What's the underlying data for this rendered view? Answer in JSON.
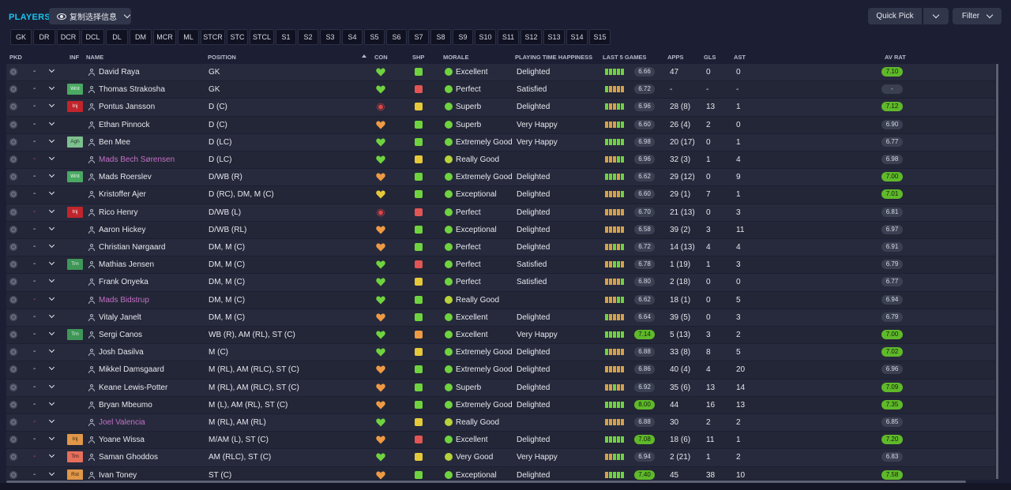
{
  "title": "PLAYERS",
  "copy_button": "复制选择信息",
  "quick_pick": "Quick Pick",
  "filter": "Filter",
  "position_tabs": [
    "GK",
    "DR",
    "DCR",
    "DCL",
    "DL",
    "DM",
    "MCR",
    "ML",
    "STCR",
    "STC",
    "STCL",
    "S1",
    "S2",
    "S3",
    "S4",
    "S5",
    "S6",
    "S7",
    "S8",
    "S9",
    "S10",
    "S11",
    "S12",
    "S13",
    "S14",
    "S15"
  ],
  "columns": {
    "pkd": "PKD",
    "inf": "INF",
    "name": "NAME",
    "position": "POSITION",
    "con": "CON",
    "shp": "SHP",
    "morale": "MORALE",
    "pth": "PLAYING TIME HAPPINESS",
    "form": "LAST 5 GAMES",
    "apps": "APPS",
    "gls": "GLS",
    "ast": "AST",
    "avrat": "AV RAT"
  },
  "colors": {
    "accent": "#19c3f0",
    "green": "#6fd33f",
    "red": "#e04343",
    "yellow": "#e5c93a",
    "orange": "#ee9a44",
    "loan": "#c470c9"
  },
  "players": [
    {
      "name": "David Raya",
      "loan": false,
      "inf": "",
      "position": "GK",
      "con": "green",
      "shp": "green-up",
      "morale": "Excellent",
      "pth": "Delighted",
      "form": [
        "g",
        "g",
        "g",
        "g",
        "g"
      ],
      "form_avg": "6.66",
      "apps": "47",
      "gls": "0",
      "ast": "0",
      "avrat": "7.10",
      "avrat_green": true,
      "dash_red": false
    },
    {
      "name": "Thomas Strakosha",
      "loan": false,
      "inf": "Wnt",
      "position": "GK",
      "con": "green",
      "shp": "red-down",
      "morale": "Perfect",
      "pth": "Satisfied",
      "form": [
        "g",
        "o",
        "o",
        "o",
        "o"
      ],
      "form_avg": "6.72",
      "apps": "-",
      "gls": "-",
      "ast": "-",
      "avrat": "-",
      "avrat_green": false,
      "dash_red": false
    },
    {
      "name": "Pontus Jansson",
      "loan": false,
      "inf": "Inj",
      "position": "D (C)",
      "con": "red",
      "shp": "yellow",
      "morale": "Superb",
      "pth": "Delighted",
      "form": [
        "g",
        "o",
        "o",
        "g",
        "g"
      ],
      "form_avg": "6.96",
      "apps": "28 (8)",
      "gls": "13",
      "ast": "1",
      "avrat": "7.12",
      "avrat_green": true,
      "dash_red": false
    },
    {
      "name": "Ethan Pinnock",
      "loan": false,
      "inf": "",
      "position": "D (C)",
      "con": "orange",
      "shp": "green-up",
      "morale": "Superb",
      "pth": "Very Happy",
      "form": [
        "o",
        "o",
        "o",
        "g",
        "g"
      ],
      "form_avg": "6.60",
      "apps": "26 (4)",
      "gls": "2",
      "ast": "0",
      "avrat": "6.90",
      "avrat_green": false,
      "dash_red": false
    },
    {
      "name": "Ben Mee",
      "loan": false,
      "inf": "Agh",
      "position": "D (LC)",
      "con": "green",
      "shp": "green-up",
      "morale": "Extremely Good",
      "pth": "Very Happy",
      "form": [
        "g",
        "g",
        "g",
        "g",
        "g"
      ],
      "form_avg": "6.98",
      "apps": "20 (17)",
      "gls": "0",
      "ast": "1",
      "avrat": "6.77",
      "avrat_green": false,
      "dash_red": false
    },
    {
      "name": "Mads Bech Sørensen",
      "loan": true,
      "inf": "",
      "position": "D (LC)",
      "con": "green",
      "shp": "yellow-dash",
      "morale": "Really Good",
      "pth": "",
      "form": [
        "o",
        "o",
        "o",
        "g",
        "g"
      ],
      "form_avg": "6.96",
      "apps": "32 (3)",
      "gls": "1",
      "ast": "4",
      "avrat": "6.98",
      "avrat_green": false,
      "dash_red": true
    },
    {
      "name": "Mads Roerslev",
      "loan": false,
      "inf": "Wnt",
      "position": "D/WB (R)",
      "con": "orange",
      "shp": "green-up",
      "morale": "Extremely Good",
      "pth": "Delighted",
      "form": [
        "g",
        "g",
        "g",
        "o",
        "g"
      ],
      "form_avg": "6.62",
      "apps": "29 (12)",
      "gls": "0",
      "ast": "9",
      "avrat": "7.00",
      "avrat_green": true,
      "dash_red": false
    },
    {
      "name": "Kristoffer Ajer",
      "loan": false,
      "inf": "",
      "position": "D (RC), DM, M (C)",
      "con": "yellow",
      "shp": "green-up",
      "morale": "Exceptional",
      "pth": "Delighted",
      "form": [
        "o",
        "o",
        "o",
        "o",
        "g"
      ],
      "form_avg": "6.60",
      "apps": "29 (1)",
      "gls": "7",
      "ast": "1",
      "avrat": "7.01",
      "avrat_green": true,
      "dash_red": false
    },
    {
      "name": "Rico Henry",
      "loan": false,
      "inf": "Inj",
      "position": "D/WB (L)",
      "con": "red",
      "shp": "red-down",
      "morale": "Perfect",
      "pth": "Delighted",
      "form": [
        "o",
        "o",
        "o",
        "o",
        "o"
      ],
      "form_avg": "6.70",
      "apps": "21 (13)",
      "gls": "0",
      "ast": "3",
      "avrat": "6.81",
      "avrat_green": false,
      "dash_red": true
    },
    {
      "name": "Aaron Hickey",
      "loan": false,
      "inf": "",
      "position": "D/WB (RL)",
      "con": "orange",
      "shp": "green-up",
      "morale": "Exceptional",
      "pth": "Delighted",
      "form": [
        "o",
        "o",
        "o",
        "o",
        "o"
      ],
      "form_avg": "6.58",
      "apps": "39 (2)",
      "gls": "3",
      "ast": "11",
      "avrat": "6.97",
      "avrat_green": false,
      "dash_red": false
    },
    {
      "name": "Christian Nørgaard",
      "loan": false,
      "inf": "",
      "position": "DM, M (C)",
      "con": "orange",
      "shp": "green-up",
      "morale": "Perfect",
      "pth": "Delighted",
      "form": [
        "o",
        "o",
        "g",
        "o",
        "g"
      ],
      "form_avg": "6.72",
      "apps": "14 (13)",
      "gls": "4",
      "ast": "4",
      "avrat": "6.91",
      "avrat_green": false,
      "dash_red": false
    },
    {
      "name": "Mathias Jensen",
      "loan": false,
      "inf": "Trn",
      "position": "DM, M (C)",
      "con": "green",
      "shp": "red-down",
      "morale": "Perfect",
      "pth": "Satisfied",
      "form": [
        "o",
        "o",
        "g",
        "g",
        "o"
      ],
      "form_avg": "6.78",
      "apps": "1 (19)",
      "gls": "1",
      "ast": "3",
      "avrat": "6.79",
      "avrat_green": false,
      "dash_red": false
    },
    {
      "name": "Frank Onyeka",
      "loan": false,
      "inf": "",
      "position": "DM, M (C)",
      "con": "green",
      "shp": "yellow",
      "morale": "Perfect",
      "pth": "Satisfied",
      "form": [
        "o",
        "o",
        "o",
        "o",
        "g"
      ],
      "form_avg": "6.80",
      "apps": "2 (18)",
      "gls": "0",
      "ast": "0",
      "avrat": "6.77",
      "avrat_green": false,
      "dash_red": false
    },
    {
      "name": "Mads Bidstrup",
      "loan": true,
      "inf": "",
      "position": "DM, M (C)",
      "con": "green",
      "shp": "green-up",
      "morale": "Really Good",
      "pth": "",
      "form": [
        "o",
        "o",
        "o",
        "g",
        "g"
      ],
      "form_avg": "6.62",
      "apps": "18 (1)",
      "gls": "0",
      "ast": "5",
      "avrat": "6.94",
      "avrat_green": false,
      "dash_red": true
    },
    {
      "name": "Vitaly Janelt",
      "loan": false,
      "inf": "",
      "position": "DM, M (C)",
      "con": "orange",
      "shp": "green-up",
      "morale": "Excellent",
      "pth": "Delighted",
      "form": [
        "g",
        "o",
        "o",
        "o",
        "o"
      ],
      "form_avg": "6.64",
      "apps": "39 (5)",
      "gls": "0",
      "ast": "3",
      "avrat": "6.79",
      "avrat_green": false,
      "dash_red": false
    },
    {
      "name": "Sergi Canos",
      "loan": false,
      "inf": "Trn",
      "position": "WB (R), AM (RL), ST (C)",
      "con": "green",
      "shp": "orange",
      "morale": "Excellent",
      "pth": "Very Happy",
      "form": [
        "g",
        "g",
        "g",
        "g",
        "g"
      ],
      "form_avg": "7.14",
      "form_green": true,
      "apps": "5 (13)",
      "gls": "3",
      "ast": "2",
      "avrat": "7.00",
      "avrat_green": true,
      "dash_red": false
    },
    {
      "name": "Josh Dasilva",
      "loan": false,
      "inf": "",
      "position": "M (C)",
      "con": "green",
      "shp": "yellow",
      "morale": "Extremely Good",
      "pth": "Delighted",
      "form": [
        "g",
        "o",
        "o",
        "o",
        "o"
      ],
      "form_avg": "6.88",
      "apps": "33 (8)",
      "gls": "8",
      "ast": "5",
      "avrat": "7.02",
      "avrat_green": true,
      "dash_red": false
    },
    {
      "name": "Mikkel Damsgaard",
      "loan": false,
      "inf": "",
      "position": "M (RL), AM (RLC), ST (C)",
      "con": "orange",
      "shp": "green-up",
      "morale": "Extremely Good",
      "pth": "Delighted",
      "form": [
        "o",
        "o",
        "o",
        "o",
        "o"
      ],
      "form_avg": "6.86",
      "apps": "40 (4)",
      "gls": "4",
      "ast": "20",
      "avrat": "6.96",
      "avrat_green": false,
      "dash_red": false
    },
    {
      "name": "Keane Lewis-Potter",
      "loan": false,
      "inf": "",
      "position": "M (RL), AM (RLC), ST (C)",
      "con": "orange",
      "shp": "green-up",
      "morale": "Superb",
      "pth": "Delighted",
      "form": [
        "o",
        "o",
        "g",
        "o",
        "o"
      ],
      "form_avg": "6.92",
      "apps": "35 (6)",
      "gls": "13",
      "ast": "14",
      "avrat": "7.09",
      "avrat_green": true,
      "dash_red": false
    },
    {
      "name": "Bryan Mbeumo",
      "loan": false,
      "inf": "",
      "position": "M (L), AM (RL), ST (C)",
      "con": "orange",
      "shp": "green-up",
      "morale": "Extremely Good",
      "pth": "Delighted",
      "form": [
        "g",
        "g",
        "g",
        "g",
        "g"
      ],
      "form_avg": "8.00",
      "form_green": true,
      "apps": "44",
      "gls": "16",
      "ast": "13",
      "avrat": "7.35",
      "avrat_green": true,
      "dash_red": false
    },
    {
      "name": "Joel Valencia",
      "loan": true,
      "inf": "",
      "position": "M (RL), AM (RL)",
      "con": "green",
      "shp": "yellow-dash",
      "morale": "Really Good",
      "pth": "",
      "form": [
        "o",
        "o",
        "o",
        "o",
        "o"
      ],
      "form_avg": "6.88",
      "apps": "30",
      "gls": "2",
      "ast": "2",
      "avrat": "6.85",
      "avrat_green": false,
      "dash_red": true
    },
    {
      "name": "Yoane Wissa",
      "loan": false,
      "inf": "Inj2",
      "inf_label": "Inj",
      "position": "M/AM (L), ST (C)",
      "con": "orange",
      "shp": "red-down",
      "morale": "Excellent",
      "pth": "Delighted",
      "form": [
        "g",
        "g",
        "g",
        "g",
        "g"
      ],
      "form_avg": "7.08",
      "form_green": true,
      "apps": "18 (6)",
      "gls": "11",
      "ast": "1",
      "avrat": "7.20",
      "avrat_green": true,
      "dash_red": false
    },
    {
      "name": "Saman Ghoddos",
      "loan": false,
      "inf": "TrnRed",
      "inf_label": "Trn",
      "position": "AM (RLC), ST (C)",
      "con": "green",
      "shp": "yellow",
      "morale": "Very Good",
      "pth": "Very Happy",
      "form": [
        "o",
        "o",
        "g",
        "g",
        "g"
      ],
      "form_avg": "6.94",
      "apps": "2 (21)",
      "gls": "1",
      "ast": "2",
      "avrat": "6.83",
      "avrat_green": false,
      "dash_red": true
    },
    {
      "name": "Ivan Toney",
      "loan": false,
      "inf": "Rst",
      "position": "ST (C)",
      "con": "orange",
      "shp": "green-up",
      "morale": "Exceptional",
      "pth": "Delighted",
      "form": [
        "o",
        "g",
        "g",
        "g",
        "g"
      ],
      "form_avg": "7.40",
      "form_green": true,
      "apps": "45",
      "gls": "38",
      "ast": "10",
      "avrat": "7.58",
      "avrat_green": true,
      "dash_red": false
    }
  ]
}
